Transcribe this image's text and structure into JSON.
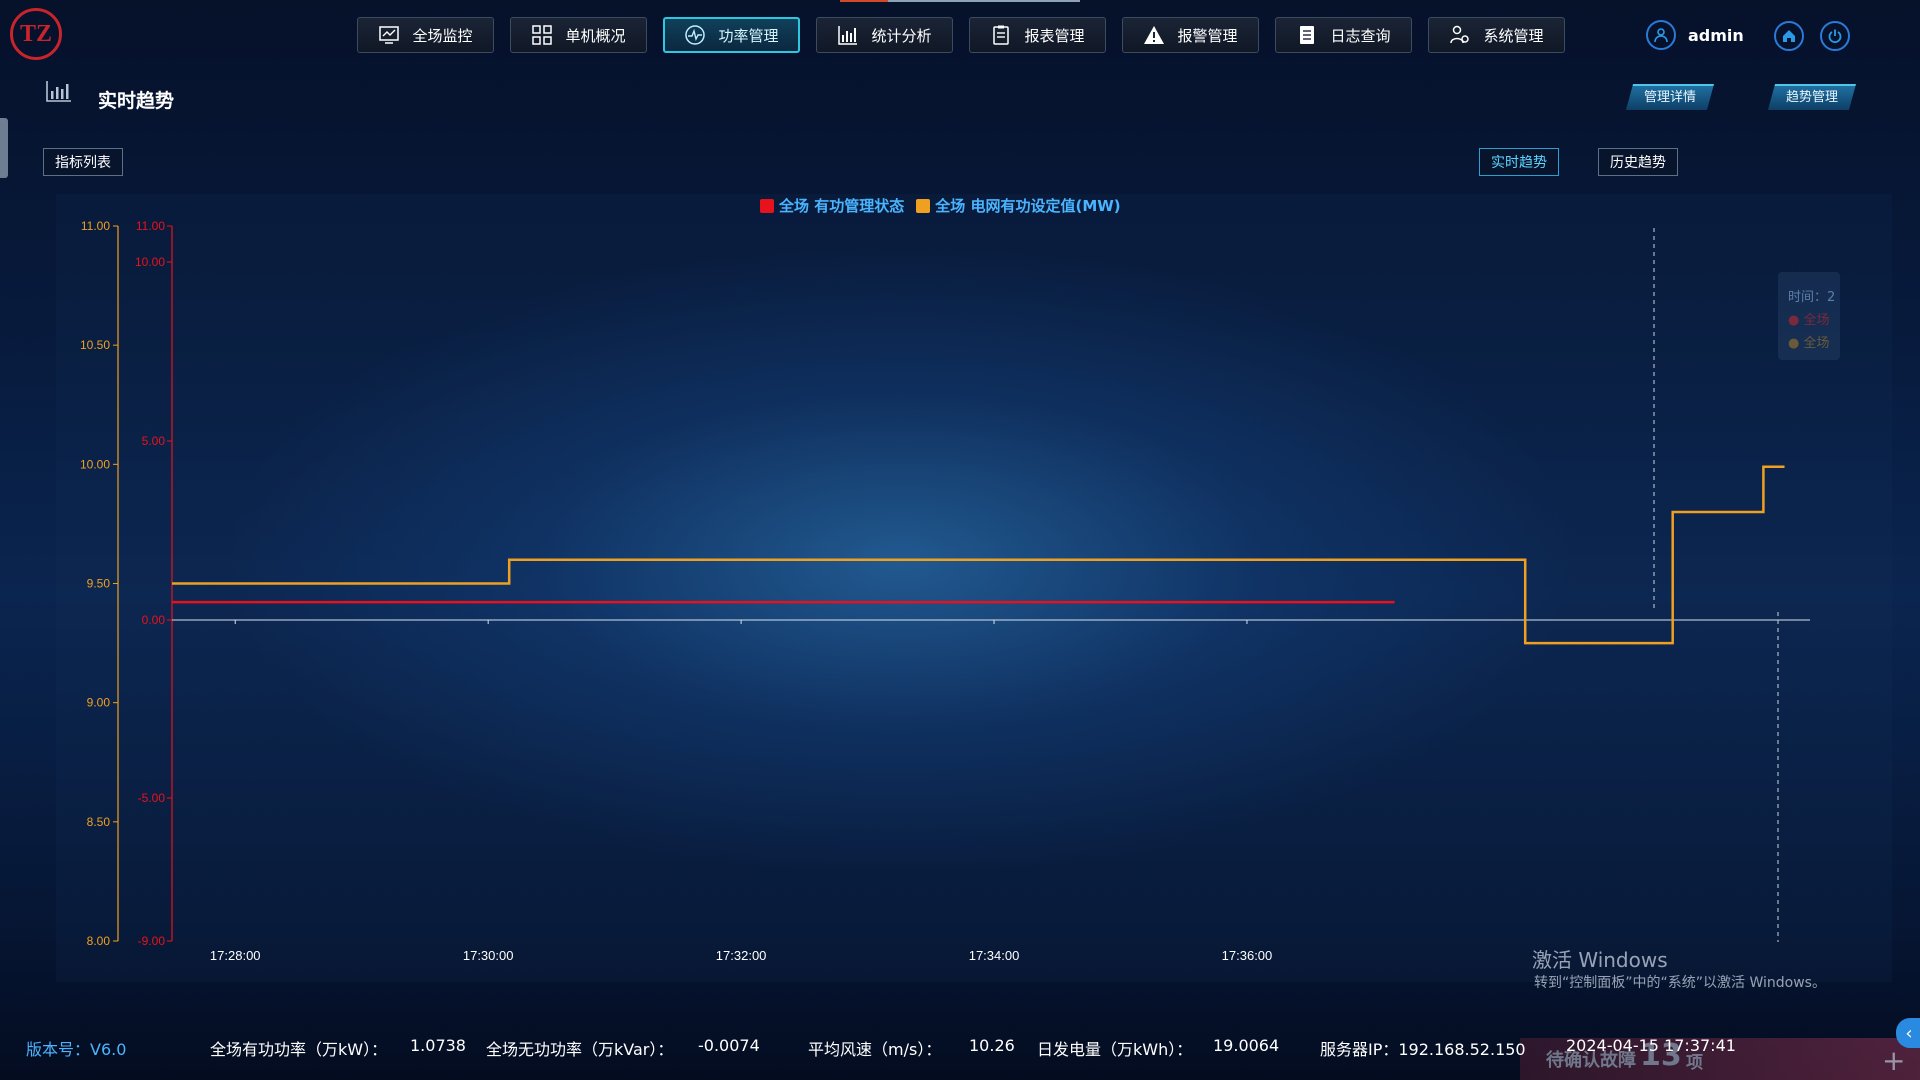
{
  "header": {
    "logo_text": "TZ",
    "nav": [
      {
        "label": "全场监控",
        "icon": "monitor-icon",
        "active": false
      },
      {
        "label": "单机概况",
        "icon": "grid-icon",
        "active": false
      },
      {
        "label": "功率管理",
        "icon": "power-gauge-icon",
        "active": true
      },
      {
        "label": "统计分析",
        "icon": "bar-chart-icon",
        "active": false
      },
      {
        "label": "报表管理",
        "icon": "clipboard-icon",
        "active": false
      },
      {
        "label": "报警管理",
        "icon": "warning-icon",
        "active": false
      },
      {
        "label": "日志查询",
        "icon": "log-icon",
        "active": false
      },
      {
        "label": "系统管理",
        "icon": "users-settings-icon",
        "active": false
      }
    ],
    "user": "admin"
  },
  "page": {
    "title": "实时趋势",
    "mgmt_detail": "管理详情",
    "trend_mgmt": "趋势管理",
    "indicator_list": "指标列表",
    "realtime_trend": "实时趋势",
    "history_trend": "历史趋势"
  },
  "chart_data": {
    "type": "line",
    "series": [
      {
        "name": "全场 有功管理状态",
        "color": "#e8121c",
        "axis": "right",
        "points": [
          [
            "17:27:30",
            0.5
          ],
          [
            "17:37:10",
            0.5
          ]
        ]
      },
      {
        "name": "全场 电网有功设定值(MW)",
        "color": "#f0a020",
        "axis": "left",
        "points": [
          [
            "17:27:30",
            9.5
          ],
          [
            "17:30:10",
            9.5
          ],
          [
            "17:30:10",
            9.6
          ],
          [
            "17:38:12",
            9.6
          ],
          [
            "17:38:12",
            9.25
          ],
          [
            "17:39:22",
            9.25
          ],
          [
            "17:39:22",
            9.8
          ],
          [
            "17:40:05",
            9.8
          ],
          [
            "17:40:05",
            9.99
          ],
          [
            "17:40:15",
            9.99
          ]
        ]
      }
    ],
    "left_axis": {
      "ticks": [
        "11.00",
        "10.50",
        "10.00",
        "9.50",
        "9.00",
        "8.50",
        "8.00"
      ],
      "range": [
        8.0,
        11.0
      ],
      "color": "#f0a020"
    },
    "right_axis": {
      "ticks": [
        "11.00",
        "10.00",
        "5.00",
        "0.00",
        "-5.00",
        "-9.00"
      ],
      "range": [
        -9.0,
        11.0
      ],
      "color": "#e8121c"
    },
    "x_ticks": [
      "17:28:00",
      "17:30:00",
      "17:32:00",
      "17:34:00",
      "17:36:00"
    ],
    "tooltip_ghost": [
      "时间：2",
      "● 全场",
      "● 全场"
    ]
  },
  "watermark": {
    "line1": "激活 Windows",
    "line2": "转到“控制面板”中的“系统”以激活 Windows。"
  },
  "footer": {
    "version": "版本号：V6.0",
    "active_power_label": "全场有功功率（万kW）：",
    "active_power_value": "1.0738",
    "reactive_power_label": "全场无功功率（万kVar）：",
    "reactive_power_value": "-0.0074",
    "wind_label": "平均风速（m/s）：",
    "wind_value": "10.26",
    "energy_label": "日发电量（万kWh）：",
    "energy_value": "19.0064",
    "server_ip": "服务器IP：192.168.52.150",
    "datetime": "2024-04-15 17:37:41",
    "alarm_text": "待确认故障",
    "alarm_count": "13",
    "alarm_unit": "项"
  }
}
